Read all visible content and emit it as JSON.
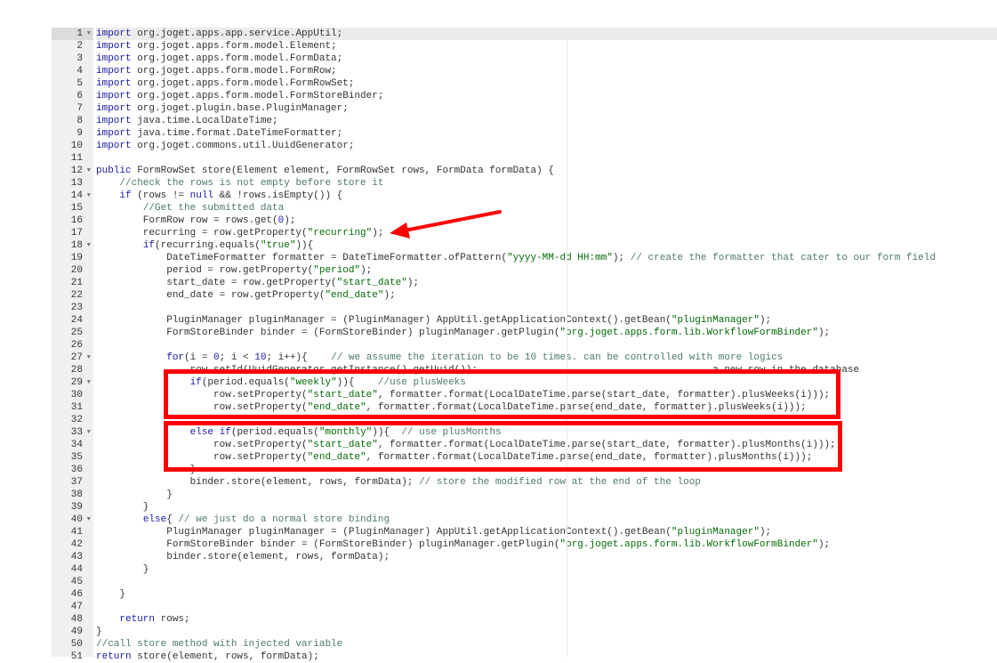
{
  "editor": {
    "active_line": 1,
    "fold_lines": [
      1,
      12,
      14,
      18,
      27,
      29,
      33,
      40
    ],
    "lines": [
      "import org.joget.apps.app.service.AppUtil;",
      "import org.joget.apps.form.model.Element;",
      "import org.joget.apps.form.model.FormData;",
      "import org.joget.apps.form.model.FormRow;",
      "import org.joget.apps.form.model.FormRowSet;",
      "import org.joget.apps.form.model.FormStoreBinder;",
      "import org.joget.plugin.base.PluginManager;",
      "import java.time.LocalDateTime;",
      "import java.time.format.DateTimeFormatter;",
      "import org.joget.commons.util.UuidGenerator;",
      "",
      "public FormRowSet store(Element element, FormRowSet rows, FormData formData) {",
      "    //check the rows is not empty before store it",
      "    if (rows != null && !rows.isEmpty()) {",
      "        //Get the submitted data",
      "        FormRow row = rows.get(0);",
      "        recurring = row.getProperty(\"recurring\");",
      "        if(recurring.equals(\"true\")){",
      "            DateTimeFormatter formatter = DateTimeFormatter.ofPattern(\"yyyy-MM-dd HH:mm\"); // create the formatter that cater to our form field",
      "            period = row.getProperty(\"period\");",
      "            start_date = row.getProperty(\"start_date\");",
      "            end_date = row.getProperty(\"end_date\");",
      "",
      "            PluginManager pluginManager = (PluginManager) AppUtil.getApplicationContext().getBean(\"pluginManager\");",
      "            FormStoreBinder binder = (FormStoreBinder) pluginManager.getPlugin(\"org.joget.apps.form.lib.WorkflowFormBinder\");",
      "",
      "            for(i = 0; i < 10; i++){    // we assume the iteration to be 10 times. can be controlled with more logics",
      "                row.setId(UuidGenerator.getInstance().getUuid());                                        a new row in the database",
      "                if(period.equals(\"weekly\")){    //use plusWeeks",
      "                    row.setProperty(\"start_date\", formatter.format(LocalDateTime.parse(start_date, formatter).plusWeeks(i)));",
      "                    row.setProperty(\"end_date\", formatter.format(LocalDateTime.parse(end_date, formatter).plusWeeks(i)));",
      "",
      "                else if(period.equals(\"monthly\")){  // use plusMonths",
      "                    row.setProperty(\"start_date\", formatter.format(LocalDateTime.parse(start_date, formatter).plusMonths(i)));",
      "                    row.setProperty(\"end_date\", formatter.format(LocalDateTime.parse(end_date, formatter).plusMonths(i)));",
      "                }",
      "                binder.store(element, rows, formData); // store the modified row at the end of the loop",
      "            }",
      "        }",
      "        else{ // we just do a normal store binding",
      "            PluginManager pluginManager = (PluginManager) AppUtil.getApplicationContext().getBean(\"pluginManager\");",
      "            FormStoreBinder binder = (FormStoreBinder) pluginManager.getPlugin(\"org.joget.apps.form.lib.WorkflowFormBinder\");",
      "            binder.store(element, rows, formData);",
      "        }",
      "",
      "    }",
      "",
      "    return rows;",
      "}",
      "//call store method with injected variable",
      "return store(element, rows, formData);"
    ]
  },
  "annotations": {
    "color": "#ff0000"
  }
}
